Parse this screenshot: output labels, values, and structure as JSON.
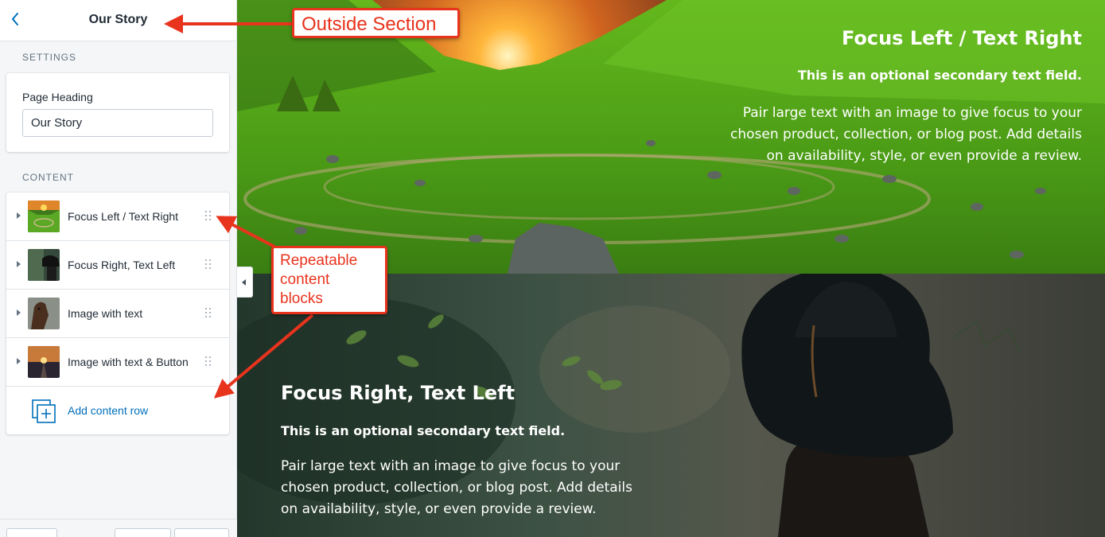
{
  "sidebar": {
    "title": "Our Story",
    "settings_label": "SETTINGS",
    "page_heading_label": "Page Heading",
    "page_heading_value": "Our Story",
    "content_label": "CONTENT",
    "rows": [
      {
        "label": "Focus Left / Text Right"
      },
      {
        "label": "Focus Right, Text Left"
      },
      {
        "label": "Image with text"
      },
      {
        "label": "Image with text & Button"
      }
    ],
    "add_label": "Add content row"
  },
  "preview": {
    "block1": {
      "title": "Focus Left / Text Right",
      "subtitle": "This is an optional secondary text field.",
      "body_lines": [
        "Pair large text with an image to give focus to your",
        "chosen product, collection, or blog post. Add details",
        "on availability, style, or even provide a review."
      ]
    },
    "block2": {
      "title": "Focus Right, Text Left",
      "subtitle": "This is an optional secondary text field.",
      "body_lines": [
        "Pair large text with an image to give focus to your",
        "chosen product, collection, or blog post. Add details",
        "on availability, style, or even provide a review."
      ]
    }
  },
  "annotations": {
    "outside": "Outside Section",
    "repeatable_lines": [
      "Repeatable",
      "content",
      "blocks"
    ]
  },
  "colors": {
    "accent": "#006fbb",
    "annotation": "#e8331d"
  }
}
